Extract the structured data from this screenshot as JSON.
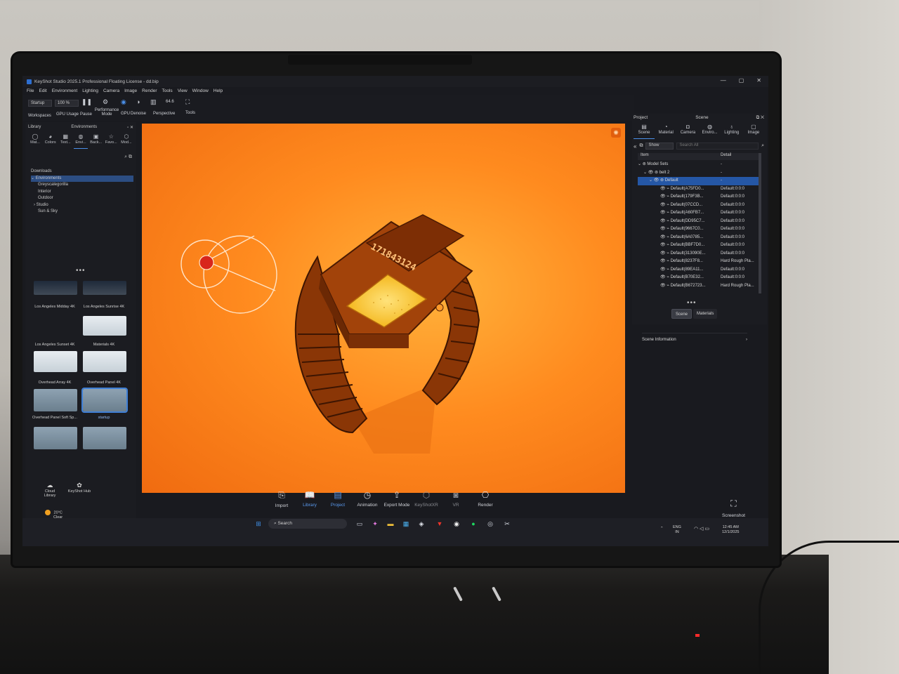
{
  "window": {
    "title": "KeyShot Studio 2025.1 Professional Floating License - dd.bip",
    "controls": [
      "—",
      "▢",
      "✕"
    ]
  },
  "menu": [
    "File",
    "Edit",
    "Environment",
    "Lighting",
    "Camera",
    "Image",
    "Render",
    "Tools",
    "View",
    "Window",
    "Help"
  ],
  "toolbar": {
    "workspace_value": "Startup",
    "zoom_value": "100 %",
    "fps_value": "64.6",
    "labels": {
      "workspaces": "Workspaces",
      "gpu_usage": "GPU Usage",
      "pause": "Pause",
      "performance": "Performance Mode",
      "gpu": "GPU",
      "denoise": "Denoise",
      "perspective": "Perspective",
      "tools": "Tools"
    }
  },
  "library": {
    "title_left": "Library",
    "title": "Environments",
    "tabs": [
      "Mat...",
      "Colors",
      "Text...",
      "Envi...",
      "Back...",
      "Favo...",
      "Mod..."
    ],
    "tree": [
      "Downloads",
      "Environments",
      "Greyscalegorilla",
      "Interior",
      "Outdoor",
      "Studio",
      "Sun & Sky"
    ],
    "thumbs": [
      "Los Angeles Midday 4K",
      "Los Angeles Sunrise 4K",
      "Los Angeles Sunset 4K",
      "Materials 4K",
      "Overhead Array 4K",
      "Overhead Panel 4K",
      "Overhead Panel Soft Sp...",
      "startup"
    ],
    "cloud": "Cloud Library",
    "hub": "KeyShot Hub"
  },
  "viewport": {
    "display_digits": "171843124"
  },
  "bottom_bar": {
    "items": [
      "Import",
      "Library",
      "Project",
      "Animation",
      "Export Mode",
      "KeyShotXR",
      "VR",
      "Render"
    ],
    "screenshot": "Screenshot"
  },
  "project": {
    "title_left": "Project",
    "title": "Scene",
    "tabs": [
      "Scene",
      "Material",
      "Camera",
      "Enviro...",
      "Lighting",
      "Image"
    ],
    "show_value": "Show",
    "search_placeholder": "Search All",
    "col_item": "Item",
    "col_detail": "Detail",
    "rows": [
      {
        "item": "Model Sets",
        "detail": "-"
      },
      {
        "item": "belt 2",
        "detail": "-"
      },
      {
        "item": "Default",
        "detail": "-"
      },
      {
        "item": "Default(A75FD0...",
        "detail": "Default:0:0:0"
      },
      {
        "item": "Default(179F3B...",
        "detail": "Default:0:0:0"
      },
      {
        "item": "Default(07CCD...",
        "detail": "Default:0:0:0"
      },
      {
        "item": "Default(A60FB7...",
        "detail": "Default:0:0:0"
      },
      {
        "item": "Default(DD95C7...",
        "detail": "Default:0:0:0"
      },
      {
        "item": "Default(9667C0...",
        "detail": "Default:0:0:0"
      },
      {
        "item": "Default(6A0785...",
        "detail": "Default:0:0:0"
      },
      {
        "item": "Default(BBF7D0...",
        "detail": "Default:0:0:0"
      },
      {
        "item": "Default(313090E...",
        "detail": "Default:0:0:0"
      },
      {
        "item": "Default(8237F8...",
        "detail": "Hard Rough Pla..."
      },
      {
        "item": "Default(89EA11...",
        "detail": "Default:0:0:0"
      },
      {
        "item": "Default(B70E32...",
        "detail": "Default:0:0:0"
      },
      {
        "item": "Default(B672723...",
        "detail": "Hard Rough Pla..."
      }
    ],
    "btn_scene": "Scene",
    "btn_materials": "Materials",
    "scene_info": "Scene Information"
  },
  "taskbar": {
    "search": "Search",
    "weather_temp": "20°C",
    "weather_desc": "Clear",
    "lang": "ENG",
    "region": "IN",
    "time": "12:45 AM",
    "date": "12/1/2025"
  }
}
